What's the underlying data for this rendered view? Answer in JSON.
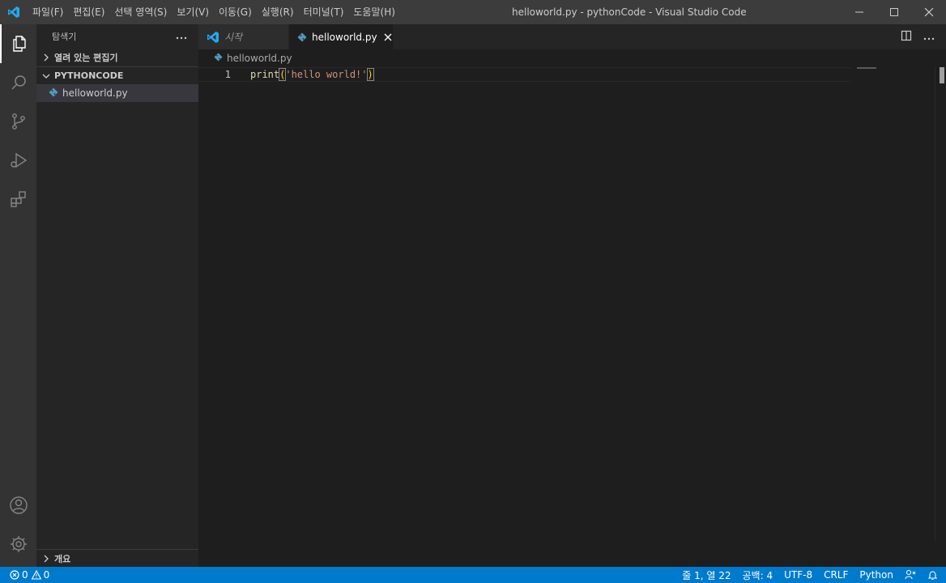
{
  "titlebar": {
    "menu": [
      "파일(F)",
      "편집(E)",
      "선택 영역(S)",
      "보기(V)",
      "이동(G)",
      "실행(R)",
      "터미널(T)",
      "도움말(H)"
    ],
    "window_title": "helloworld.py - pythonCode - Visual Studio Code"
  },
  "activitybar": {
    "items": [
      "explorer-icon",
      "search-icon",
      "source-control-icon",
      "run-debug-icon",
      "extensions-icon"
    ],
    "bottom": [
      "account-icon",
      "gear-icon"
    ]
  },
  "sidebar": {
    "title": "탐색기",
    "open_editors": "열려 있는 편집기",
    "folder": "PYTHONCODE",
    "files": [
      "helloworld.py"
    ],
    "outline": "개요"
  },
  "editor": {
    "tabs": [
      {
        "label": "시작"
      },
      {
        "label": "helloworld.py"
      }
    ],
    "breadcrumb": "helloworld.py",
    "line_number": "1",
    "code": {
      "fn": "print",
      "open": "(",
      "str": "'hello world!'",
      "close": ")"
    }
  },
  "statusbar": {
    "errors": "0",
    "warnings": "0",
    "position": "줄 1, 열 22",
    "indent": "공백: 4",
    "encoding": "UTF-8",
    "eol": "CRLF",
    "language": "Python"
  },
  "colors": {
    "statusbar": "#007acc",
    "titlebar": "#3c3c3c",
    "activitybar": "#333333",
    "sidebar": "#252526",
    "editor": "#1e1e1e",
    "vscode_blue": "#0098ff"
  }
}
